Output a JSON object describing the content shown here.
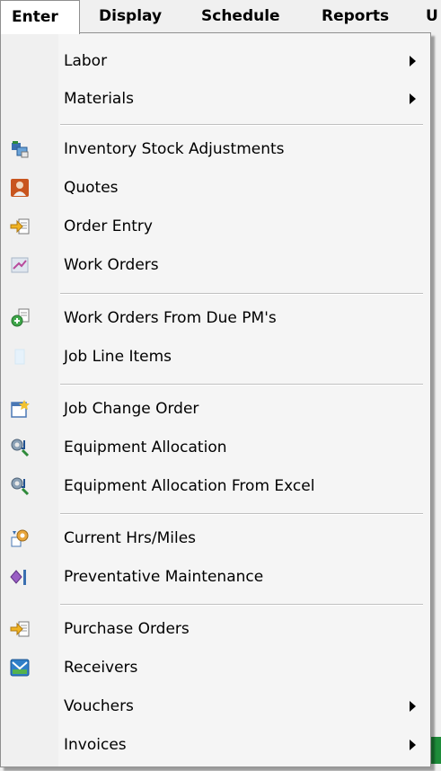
{
  "menubar": {
    "items": [
      "Enter",
      "Display",
      "Schedule",
      "Reports",
      "U"
    ]
  },
  "menu": {
    "items": [
      {
        "label": "Labor",
        "submenu": true,
        "icon": null
      },
      {
        "label": "Materials",
        "submenu": true,
        "icon": null
      },
      {
        "label": "Inventory Stock Adjustments",
        "submenu": false,
        "icon": "inventory-adjust-icon"
      },
      {
        "label": "Quotes",
        "submenu": false,
        "icon": "quotes-icon"
      },
      {
        "label": "Order Entry",
        "submenu": false,
        "icon": "order-entry-icon"
      },
      {
        "label": "Work Orders",
        "submenu": false,
        "icon": "work-orders-icon"
      },
      {
        "label": "Work Orders From Due PM's",
        "submenu": false,
        "icon": "work-orders-pm-icon"
      },
      {
        "label": "Job Line Items",
        "submenu": false,
        "icon": "job-line-items-icon"
      },
      {
        "label": "Job Change Order",
        "submenu": false,
        "icon": "job-change-order-icon"
      },
      {
        "label": "Equipment Allocation",
        "submenu": false,
        "icon": "equipment-allocation-icon"
      },
      {
        "label": "Equipment Allocation From Excel",
        "submenu": false,
        "icon": "equipment-allocation-excel-icon"
      },
      {
        "label": "Current Hrs/Miles",
        "submenu": false,
        "icon": "current-hrs-miles-icon"
      },
      {
        "label": "Preventative Maintenance",
        "submenu": false,
        "icon": "preventative-maintenance-icon"
      },
      {
        "label": "Purchase Orders",
        "submenu": false,
        "icon": "purchase-orders-icon"
      },
      {
        "label": "Receivers",
        "submenu": false,
        "icon": "receivers-icon"
      },
      {
        "label": "Vouchers",
        "submenu": true,
        "icon": null
      },
      {
        "label": "Invoices",
        "submenu": true,
        "icon": null
      }
    ]
  }
}
